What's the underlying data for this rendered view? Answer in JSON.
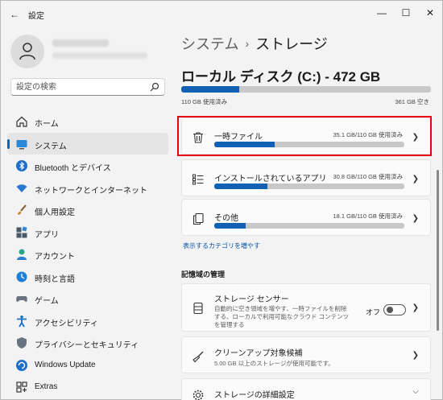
{
  "window": {
    "app_title": "設定",
    "back_glyph": "←",
    "min_glyph": "—",
    "max_glyph": "☐",
    "close_glyph": "✕"
  },
  "search": {
    "placeholder": "設定の検索"
  },
  "sidebar": {
    "items": [
      {
        "label": "ホーム",
        "icon": "home-icon",
        "active": false
      },
      {
        "label": "システム",
        "icon": "system-icon",
        "active": true
      },
      {
        "label": "Bluetooth とデバイス",
        "icon": "bluetooth-icon",
        "active": false
      },
      {
        "label": "ネットワークとインターネット",
        "icon": "wifi-icon",
        "active": false
      },
      {
        "label": "個人用設定",
        "icon": "brush-icon",
        "active": false
      },
      {
        "label": "アプリ",
        "icon": "apps-icon",
        "active": false
      },
      {
        "label": "アカウント",
        "icon": "account-icon",
        "active": false
      },
      {
        "label": "時刻と言語",
        "icon": "time-language-icon",
        "active": false
      },
      {
        "label": "ゲーム",
        "icon": "gamepad-icon",
        "active": false
      },
      {
        "label": "アクセシビリティ",
        "icon": "accessibility-icon",
        "active": false
      },
      {
        "label": "プライバシーとセキュリティ",
        "icon": "shield-icon",
        "active": false
      },
      {
        "label": "Windows Update",
        "icon": "update-icon",
        "active": false
      },
      {
        "label": "Extras",
        "icon": "extras-icon",
        "active": false
      }
    ]
  },
  "breadcrumb": {
    "parent": "システム",
    "separator": "›",
    "current": "ストレージ"
  },
  "disk": {
    "title": "ローカル ディスク (C:) - 472 GB",
    "used_label": "110 GB 使用済み",
    "free_label": "361 GB 空き",
    "used_fraction": 0.233
  },
  "categories": [
    {
      "title": "一時ファイル",
      "usage": "35.1 GB/110 GB 使用済み",
      "fraction": 0.319,
      "icon": "trash-icon"
    },
    {
      "title": "インストールされているアプリ",
      "usage": "30.8 GB/110 GB 使用済み",
      "fraction": 0.28,
      "icon": "apps-list-icon"
    },
    {
      "title": "その他",
      "usage": "18.1 GB/110 GB 使用済み",
      "fraction": 0.165,
      "icon": "documents-icon"
    }
  ],
  "more_categories_link": "表示するカテゴリを増やす",
  "management": {
    "section_title": "記憶域の管理",
    "storage_sense": {
      "title": "ストレージ センサー",
      "description": "自動的に空き領域を増やす、一時ファイルを削除する、ローカルで利用可能なクラウド コンテンツを管理する",
      "toggle_label": "オフ",
      "enabled": false
    },
    "cleanup": {
      "title": "クリーンアップ対象候補",
      "description": "5.00 GB 以上のストレージが使用可能です。"
    },
    "advanced": {
      "title": "ストレージの詳細設定"
    }
  },
  "colors": {
    "accent": "#0f62b3",
    "highlight": "#e60012"
  }
}
